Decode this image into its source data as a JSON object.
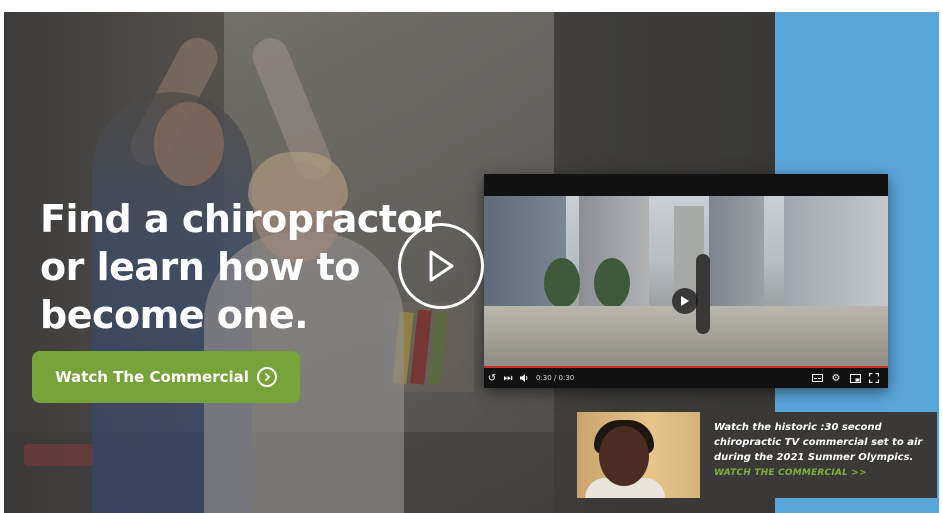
{
  "hero": {
    "headline_lines": [
      "Find a chiropractor",
      "or learn how to",
      "become one."
    ],
    "cta_label": "Watch The Commercial"
  },
  "video": {
    "time": "0:30 / 0:30"
  },
  "promo": {
    "description": "Watch the historic :30 second chiropractic TV commercial set to air during the 2021 Summer Olympics.",
    "link_label": "WATCH THE COMMERCIAL >>"
  },
  "colors": {
    "cta_green": "#76a33a",
    "accent_blue": "#5aa6db",
    "progress_red": "#c92a2a",
    "link_green": "#7fb03a"
  },
  "icons": [
    "play-circle-icon",
    "chevron-right-circle-icon",
    "play-icon",
    "replay-icon",
    "skip-icon",
    "volume-icon",
    "captions-icon",
    "settings-icon",
    "pip-icon",
    "fullscreen-icon"
  ]
}
